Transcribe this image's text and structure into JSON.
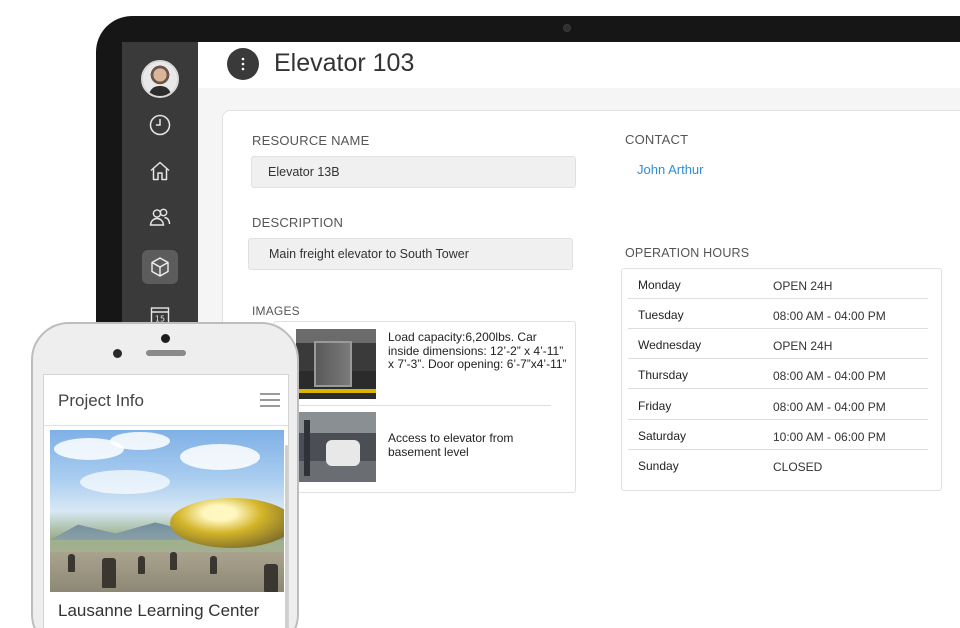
{
  "header": {
    "title": "Elevator 103"
  },
  "sidebar": {
    "items": [
      {
        "icon": "clock-icon"
      },
      {
        "icon": "home-icon"
      },
      {
        "icon": "users-icon"
      },
      {
        "icon": "cube-icon",
        "active": true
      },
      {
        "icon": "calendar-icon",
        "text": "15"
      }
    ]
  },
  "resource": {
    "label": "RESOURCE NAME",
    "value": "Elevator 13B"
  },
  "description": {
    "label": "DESCRIPTION",
    "value": "Main freight elevator to South Tower"
  },
  "contact": {
    "label": "CONTACT",
    "name": "John Arthur"
  },
  "images": {
    "label": "IMAGES",
    "items": [
      {
        "caption": "Load capacity:6,200lbs. Car inside dimensions: 12’-2” x 4’-11” x 7’-3”. Door opening: 6’-7”x4’-11”"
      },
      {
        "caption": "Access to elevator from basement level"
      }
    ]
  },
  "hours": {
    "label": "OPERATION HOURS",
    "rows": [
      {
        "day": "Monday",
        "time": "OPEN 24H"
      },
      {
        "day": "Tuesday",
        "time": "08:00 AM - 04:00 PM"
      },
      {
        "day": "Wednesday",
        "time": "OPEN 24H"
      },
      {
        "day": "Thursday",
        "time": "08:00 AM - 04:00 PM"
      },
      {
        "day": "Friday",
        "time": "08:00 AM - 04:00 PM"
      },
      {
        "day": "Saturday",
        "time": "10:00 AM - 06:00 PM"
      },
      {
        "day": "Sunday",
        "time": "CLOSED"
      }
    ]
  },
  "phone": {
    "title": "Project Info",
    "project_name": "Lausanne Learning Center"
  },
  "colors": {
    "sidebar": "#3a3a3a",
    "link": "#2c8fd6",
    "bezel": "#161616"
  }
}
